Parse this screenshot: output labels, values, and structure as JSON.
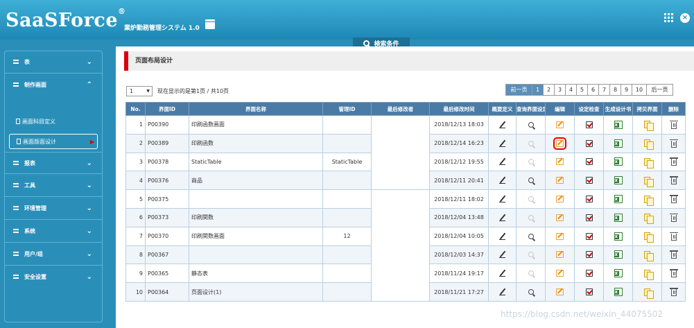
{
  "header": {
    "brand": "SaaSForce",
    "brand_mark": "®",
    "subtitle": "業炉勤務管理システム 1.0",
    "icons": [
      "doc-icon",
      "apps-icon",
      "close-icon"
    ]
  },
  "search_tab": {
    "label": "検索条件",
    "icon": "search-icon"
  },
  "sidebar": {
    "items": [
      {
        "label": "表",
        "icon": "grid-icon",
        "chevron": "⌄"
      },
      {
        "label": "制作画面",
        "icon": "grid-icon",
        "chevron": "⌃",
        "children": [
          {
            "label": "画面科目定义"
          },
          {
            "label": "画面版面设计"
          }
        ]
      },
      {
        "label": "报表",
        "icon": "grid-icon",
        "chevron": "⌄"
      },
      {
        "label": "工具",
        "icon": "grid-icon",
        "chevron": "⌄"
      },
      {
        "label": "环境管理",
        "icon": "grid-icon",
        "chevron": "⌄"
      },
      {
        "label": "系统",
        "icon": "grid-icon",
        "chevron": "⌄"
      },
      {
        "label": "用户/组",
        "icon": "grid-icon",
        "chevron": "⌄"
      },
      {
        "label": "安全设置",
        "icon": "grid-icon",
        "chevron": "⌄"
      }
    ],
    "active_marker": "▶"
  },
  "page": {
    "title": "页面布局设计",
    "page_select_value": "1",
    "page_info": "现在显示的是第1页 / 共10页"
  },
  "pager": {
    "prev": "前一页",
    "next": "后一页",
    "pages": [
      "1",
      "2",
      "3",
      "4",
      "5",
      "6",
      "7",
      "8",
      "9",
      "10"
    ],
    "current": "1"
  },
  "table": {
    "headers": [
      "No.",
      "界面ID",
      "界面名称",
      "管理ID",
      "最后修改者",
      "最后修改时间",
      "概要定义",
      "查询界面设定",
      "编辑",
      "设定检查",
      "生成设计书",
      "拷贝界面",
      "删除"
    ],
    "rows": [
      {
        "no": "1",
        "id": "P00390",
        "name": "印刷函数画面",
        "mgmt": "",
        "time": "2018/12/13 18:03",
        "query_enabled": true
      },
      {
        "no": "2",
        "id": "P00389",
        "name": "印刷函数",
        "mgmt": "",
        "time": "2018/12/14 16:23",
        "query_enabled": false
      },
      {
        "no": "3",
        "id": "P00378",
        "name": "StaticTable",
        "mgmt": "StaticTable",
        "time": "2018/12/12 19:55",
        "query_enabled": false
      },
      {
        "no": "4",
        "id": "P00376",
        "name": "商品",
        "mgmt": "",
        "time": "2018/12/11 20:41",
        "query_enabled": true
      },
      {
        "no": "5",
        "id": "P00375",
        "name": "",
        "mgmt": "",
        "time": "2018/12/11 18:02",
        "query_enabled": false
      },
      {
        "no": "6",
        "id": "P00373",
        "name": "印刷関数",
        "mgmt": "",
        "time": "2018/12/04 13:48",
        "query_enabled": false
      },
      {
        "no": "7",
        "id": "P00370",
        "name": "印刷関数画面",
        "mgmt": "12",
        "time": "2018/12/04 10:05",
        "query_enabled": true
      },
      {
        "no": "8",
        "id": "P00367",
        "name": "",
        "mgmt": "",
        "time": "2018/12/03 14:37",
        "query_enabled": false
      },
      {
        "no": "9",
        "id": "P00365",
        "name": "静态表",
        "mgmt": "",
        "time": "2018/11/24 19:17",
        "query_enabled": false
      },
      {
        "no": "10",
        "id": "P00364",
        "name": "页面设计(1)",
        "mgmt": "",
        "time": "2018/11/21 17:27",
        "query_enabled": true
      }
    ],
    "row_icons": [
      "pencil-icon",
      "search-icon",
      "edit-icon",
      "check-icon",
      "excel-icon",
      "copy-icon",
      "trash-icon"
    ],
    "highlighted_edit_row": "2"
  },
  "watermark": "https://blog.csdn.net/weixin_44075502",
  "colors": {
    "header": "#1e87b5",
    "sidebar": "#2a8fb8",
    "table_header": "#4a7ba6",
    "accent_red": "#d8000e",
    "highlight": "#e00000"
  }
}
